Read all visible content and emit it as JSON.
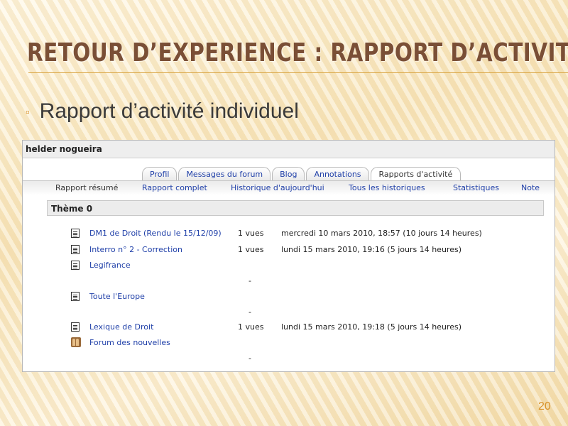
{
  "slide": {
    "title": "RETOUR D’EXPERIENCE : RAPPORT D’ACTIVITÉ",
    "bullet": "Rapport d’activité individuel",
    "page_number": "20",
    "accent_color": "#d9932b",
    "title_color": "#7a4f36"
  },
  "screenshot": {
    "user_name": "helder nogueira",
    "tabs": [
      {
        "label": "Profil",
        "active": false
      },
      {
        "label": "Messages du forum",
        "active": false
      },
      {
        "label": "Blog",
        "active": false
      },
      {
        "label": "Annotations",
        "active": false
      },
      {
        "label": "Rapports d'activité",
        "active": true
      }
    ],
    "subtabs": [
      {
        "label": "Rapport résumé",
        "active": true
      },
      {
        "label": "Rapport complet",
        "active": false
      },
      {
        "label": "Historique d'aujourd'hui",
        "active": false
      },
      {
        "label": "Tous les historiques",
        "active": false
      },
      {
        "label": "Statistiques",
        "active": false
      },
      {
        "label": "Note",
        "active": false
      }
    ],
    "section_title": "Thème 0",
    "resources": [
      {
        "icon": "document-icon",
        "name": "DM1 de Droit (Rendu le 15/12/09)",
        "views": "1 vues",
        "last_access": "mercredi 10 mars 2010, 18:57 (10 jours 14 heures)"
      },
      {
        "icon": "document-icon",
        "name": "Interro n° 2 - Correction",
        "views": "1 vues",
        "last_access": "lundi 15 mars 2010, 19:16 (5 jours 14 heures)"
      },
      {
        "icon": "document-icon",
        "name": "Legifrance",
        "views": "-",
        "last_access": ""
      },
      {
        "icon": "document-icon",
        "name": "Toute l'Europe",
        "views": "-",
        "last_access": ""
      },
      {
        "icon": "document-icon",
        "name": "Lexique de Droit",
        "views": "1 vues",
        "last_access": "lundi 15 mars 2010, 19:18 (5 jours 14 heures)"
      },
      {
        "icon": "forum-icon",
        "name": "Forum des nouvelles",
        "views": "-",
        "last_access": ""
      }
    ]
  }
}
